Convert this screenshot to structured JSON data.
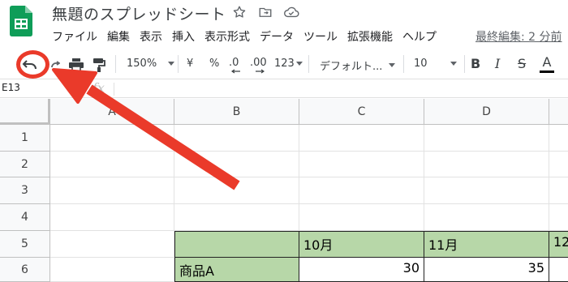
{
  "doc": {
    "title": "無題のスプレッドシート"
  },
  "title_icons": [
    "star-icon",
    "move-to-folder-icon",
    "cloud-status-icon"
  ],
  "menu": {
    "items": [
      "ファイル",
      "編集",
      "表示",
      "挿入",
      "表示形式",
      "データ",
      "ツール",
      "拡張機能",
      "ヘルプ"
    ],
    "last_edit": "最終編集: 2 分前"
  },
  "toolbar": {
    "zoom": "150%",
    "currency": "¥",
    "percent": "%",
    "decimal_decrease": ".0",
    "decimal_increase": ".00",
    "more_formats": "123",
    "font": "デフォルト...",
    "font_size": "10",
    "bold": "B",
    "italic": "I",
    "strike": "S",
    "text_color": "A"
  },
  "formula_bar": {
    "name_box": "E13",
    "fx": "fx"
  },
  "grid": {
    "columns": [
      "A",
      "B",
      "C",
      "D"
    ],
    "rows": [
      "1",
      "2",
      "3",
      "4",
      "5",
      "6"
    ],
    "cells": {
      "C5": "10月",
      "D5": "11月",
      "E5": "12",
      "B6": "商品A",
      "C6": "30",
      "D6": "35"
    },
    "header_fill": "#b7d7a8"
  },
  "annotation": {
    "color": "#ea3a2a"
  }
}
